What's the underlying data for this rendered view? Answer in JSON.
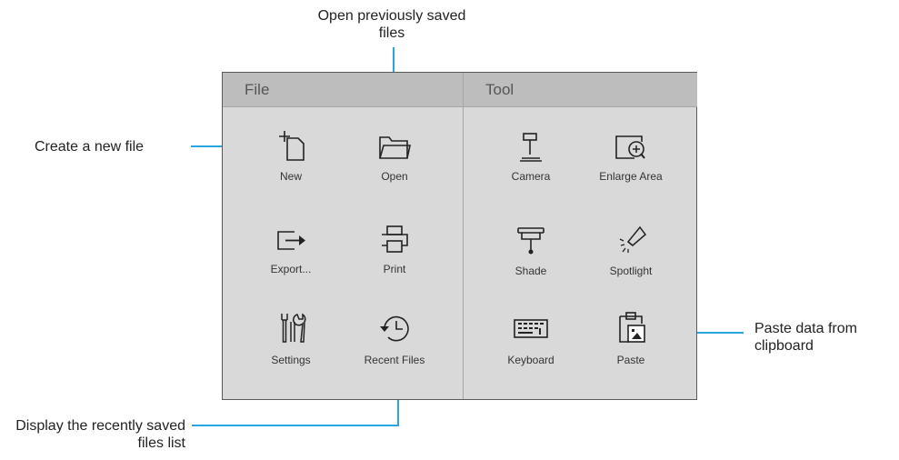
{
  "file_menu": {
    "title": "File",
    "items": [
      {
        "label": "New",
        "icon": "new-file-icon"
      },
      {
        "label": "Open",
        "icon": "folder-icon"
      },
      {
        "label": "Export...",
        "icon": "export-icon"
      },
      {
        "label": "Print",
        "icon": "printer-icon"
      },
      {
        "label": "Settings",
        "icon": "tools-icon"
      },
      {
        "label": "Recent Files",
        "icon": "history-icon"
      }
    ]
  },
  "tool_menu": {
    "title": "Tool",
    "items": [
      {
        "label": "Camera",
        "icon": "document-camera-icon"
      },
      {
        "label": "Enlarge Area",
        "icon": "magnify-icon"
      },
      {
        "label": "Shade",
        "icon": "shade-icon"
      },
      {
        "label": "Spotlight",
        "icon": "spotlight-icon"
      },
      {
        "label": "Keyboard",
        "icon": "keyboard-icon"
      },
      {
        "label": "Paste",
        "icon": "paste-icon"
      }
    ]
  },
  "callouts": {
    "open": "Open previously saved files",
    "new": "Create a new file",
    "paste": "Paste data from clipboard",
    "recent": "Display the recently saved files list"
  },
  "colors": {
    "callout_line": "#2aa6df",
    "panel": "#d9d9d9",
    "header": "#bdbdbd"
  }
}
